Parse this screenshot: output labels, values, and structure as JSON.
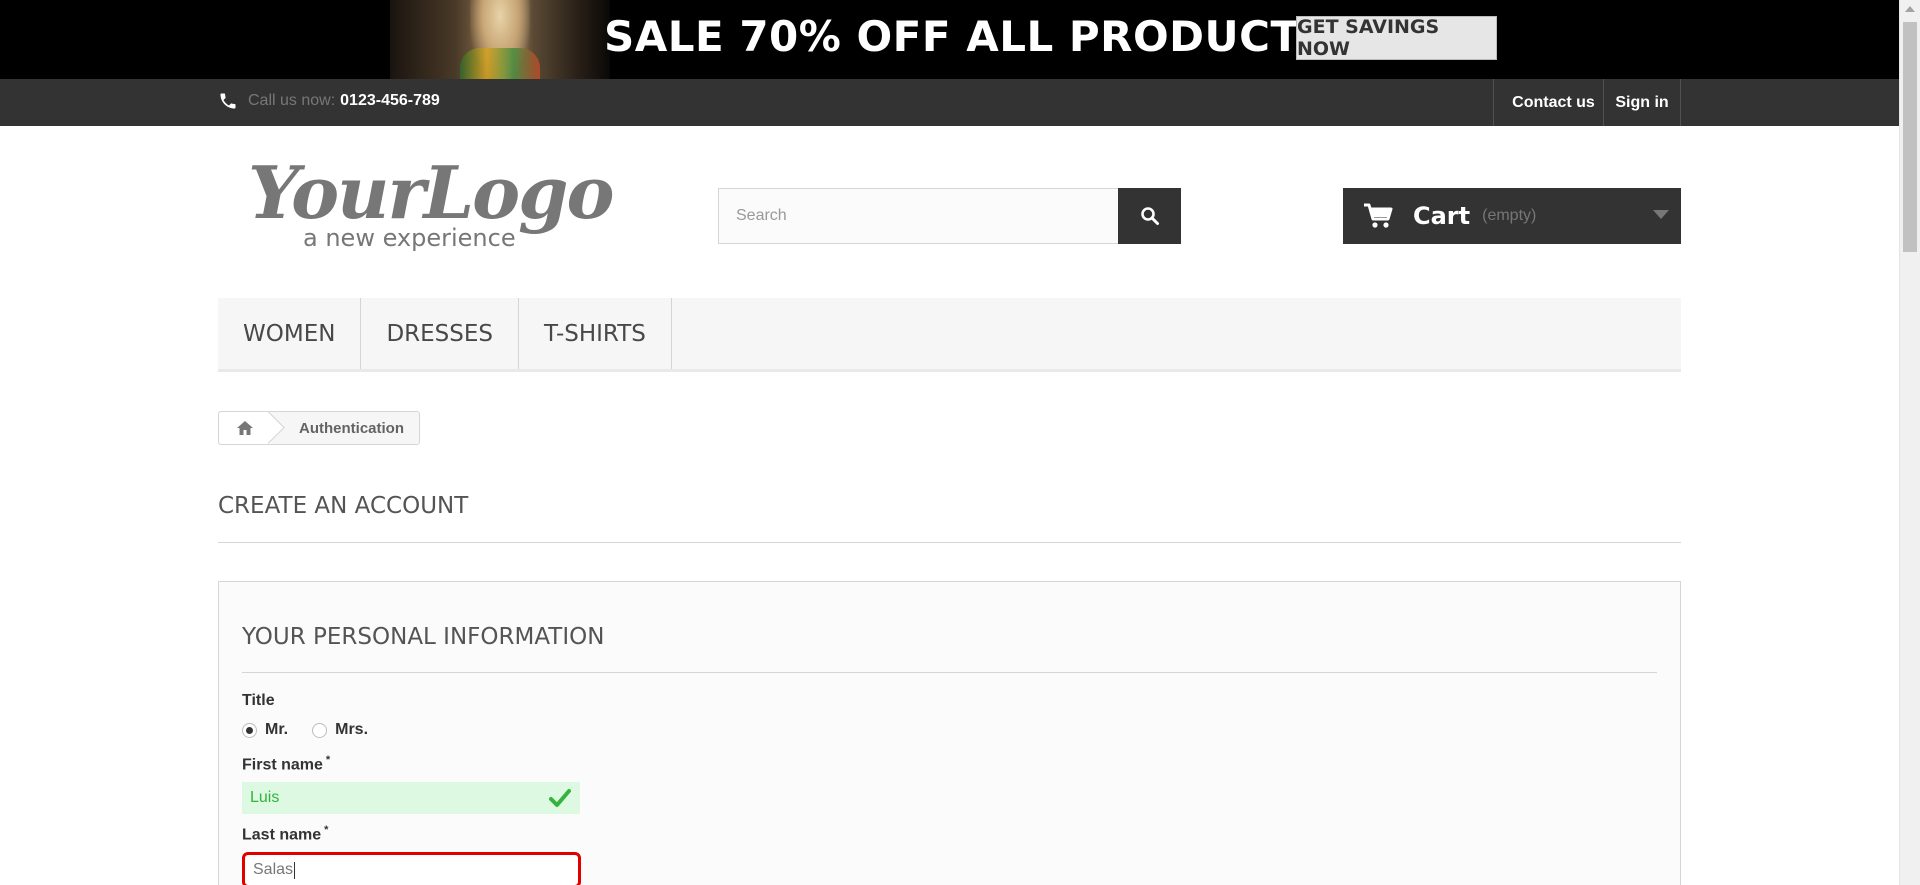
{
  "banner": {
    "headline": "SALE 70% OFF ALL PRODUCTS",
    "button": "GET SAVINGS NOW"
  },
  "topbar": {
    "call_label": "Call us now:",
    "phone": "0123-456-789",
    "contact": "Contact us",
    "signin": "Sign in"
  },
  "logo": {
    "script": "YourLogo",
    "tagline": "a new experience"
  },
  "search": {
    "placeholder": "Search"
  },
  "cart": {
    "label": "Cart",
    "status": "(empty)"
  },
  "menu": {
    "items": [
      {
        "label": "WOMEN"
      },
      {
        "label": "DRESSES"
      },
      {
        "label": "T-SHIRTS"
      }
    ]
  },
  "breadcrumb": {
    "current": "Authentication"
  },
  "page": {
    "heading": "CREATE AN ACCOUNT",
    "section": "YOUR PERSONAL INFORMATION"
  },
  "form": {
    "title_label": "Title",
    "title_options": [
      "Mr.",
      "Mrs."
    ],
    "title_selected": "Mr.",
    "first_name_label": "First name",
    "first_name_value": "Luis",
    "last_name_label": "Last name",
    "last_name_value": "Salas",
    "required_mark": "*"
  },
  "colors": {
    "dark": "#333333",
    "valid_bg": "#ddf9e1",
    "valid_text": "#35b33f",
    "error_border": "#e10000"
  }
}
